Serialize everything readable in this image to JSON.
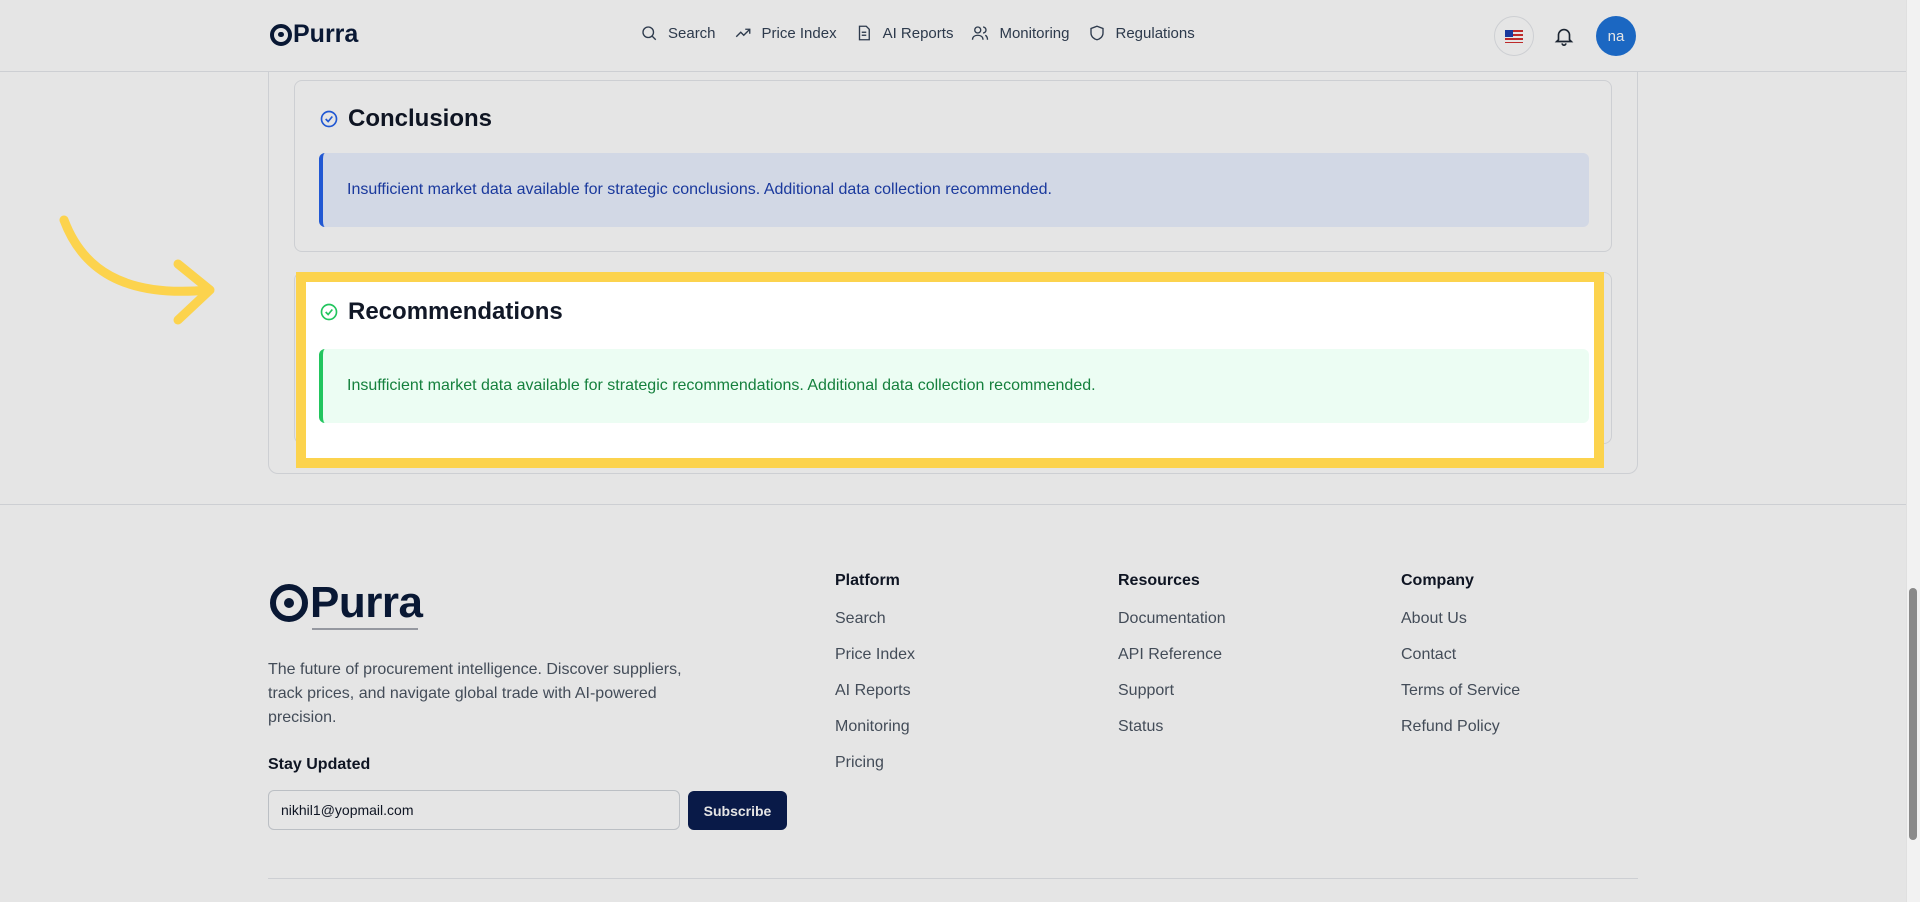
{
  "nav": {
    "brand": "Purra",
    "links": [
      {
        "label": "Search",
        "icon": "search-icon"
      },
      {
        "label": "Price Index",
        "icon": "trend-icon"
      },
      {
        "label": "AI Reports",
        "icon": "document-icon"
      },
      {
        "label": "Monitoring",
        "icon": "users-icon"
      },
      {
        "label": "Regulations",
        "icon": "shield-icon"
      }
    ],
    "flag": "us-flag-icon",
    "notifications": "bell-icon",
    "avatar_initials": "na",
    "avatar_color": "#1f73d8"
  },
  "conclusions": {
    "title": "Conclusions",
    "message": "Insufficient market data available for strategic conclusions. Additional data collection recommended.",
    "accent": "#2563eb"
  },
  "recommendations": {
    "title": "Recommendations",
    "message": "Insufficient market data available for strategic recommendations. Additional data collection recommended.",
    "accent": "#22c55e"
  },
  "annotation": {
    "highlight_color": "#fcd34d",
    "arrow": "curved-arrow-icon"
  },
  "footer": {
    "brand": "Purra",
    "description": "The future of procurement intelligence. Discover suppliers, track prices, and navigate global trade with AI-powered precision.",
    "stay_updated": "Stay Updated",
    "email_value": "nikhil1@yopmail.com",
    "subscribe_label": "Subscribe",
    "columns": [
      {
        "heading": "Platform",
        "links": [
          "Search",
          "Price Index",
          "AI Reports",
          "Monitoring",
          "Pricing"
        ]
      },
      {
        "heading": "Resources",
        "links": [
          "Documentation",
          "API Reference",
          "Support",
          "Status"
        ]
      },
      {
        "heading": "Company",
        "links": [
          "About Us",
          "Contact",
          "Terms of Service",
          "Refund Policy"
        ]
      }
    ]
  }
}
